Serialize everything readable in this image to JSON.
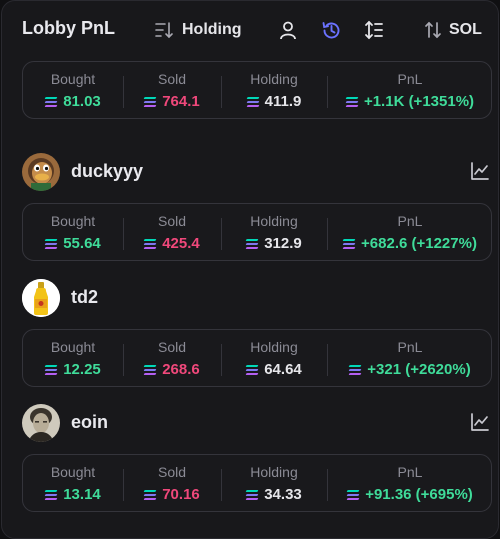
{
  "header": {
    "title": "Lobby PnL",
    "sort_label": "Holding",
    "currency_label": "SOL",
    "icons": [
      "sort-icon",
      "user-icon",
      "history-icon",
      "list-filter-icon",
      "swap-vertical-icon"
    ],
    "accent_color": "#6b72ff"
  },
  "summary": {
    "bought_label": "Bought",
    "sold_label": "Sold",
    "holding_label": "Holding",
    "pnl_label": "PnL",
    "bought": "81.03",
    "sold": "764.1",
    "holding": "411.9",
    "pnl": "+1.1K (+1351%)"
  },
  "users": [
    {
      "name": "duckyyy",
      "avatar": "duck-avatar",
      "has_chart": true,
      "bought_label": "Bought",
      "sold_label": "Sold",
      "holding_label": "Holding",
      "pnl_label": "PnL",
      "bought": "55.64",
      "sold": "425.4",
      "holding": "312.9",
      "pnl": "+682.6 (+1227%)"
    },
    {
      "name": "td2",
      "avatar": "bottle-avatar",
      "has_chart": false,
      "bought_label": "Bought",
      "sold_label": "Sold",
      "holding_label": "Holding",
      "pnl_label": "PnL",
      "bought": "12.25",
      "sold": "268.6",
      "holding": "64.64",
      "pnl": "+321 (+2620%)"
    },
    {
      "name": "eoin",
      "avatar": "portrait-avatar",
      "has_chart": true,
      "bought_label": "Bought",
      "sold_label": "Sold",
      "holding_label": "Holding",
      "pnl_label": "PnL",
      "bought": "13.14",
      "sold": "70.16",
      "holding": "34.33",
      "pnl": "+91.36 (+695%)"
    }
  ],
  "colors": {
    "positive": "#3fdc9a",
    "negative": "#f0487b",
    "neutral": "#e6e6ea"
  }
}
